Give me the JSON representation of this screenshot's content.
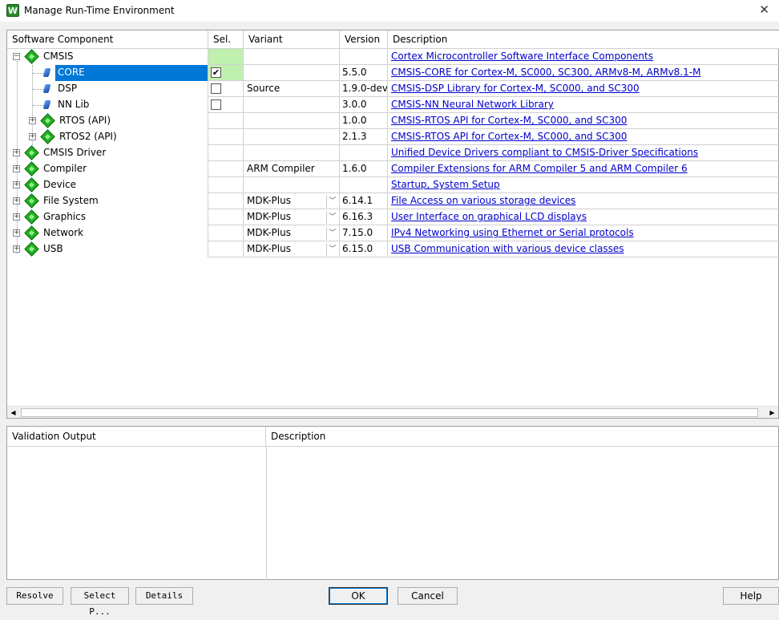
{
  "window": {
    "title": "Manage Run-Time Environment",
    "app_icon_letter": "W",
    "close_glyph": "✕"
  },
  "table": {
    "headers": {
      "component": "Software Component",
      "sel": "Sel.",
      "variant": "Variant",
      "version": "Version",
      "description": "Description"
    },
    "rows": [
      {
        "name": "CMSIS",
        "variant": "",
        "version": "",
        "description": "Cortex Microcontroller Software Interface Components",
        "expander": "−",
        "icon": "green-gem-icon"
      },
      {
        "name": "CORE",
        "variant": "",
        "version": "5.5.0",
        "description": "CMSIS-CORE for Cortex-M, SC000, SC300, ARMv8-M, ARMv8.1-M",
        "checked": "✔",
        "icon": "blue-pin-icon"
      },
      {
        "name": "DSP",
        "variant": "Source",
        "version": "1.9.0-dev",
        "description": "CMSIS-DSP Library for Cortex-M, SC000, and SC300",
        "icon": "blue-pin-icon"
      },
      {
        "name": "NN Lib",
        "variant": "",
        "version": "3.0.0",
        "description": "CMSIS-NN Neural Network Library",
        "icon": "blue-pin-icon"
      },
      {
        "name": "RTOS (API)",
        "variant": "",
        "version": "1.0.0",
        "description": "CMSIS-RTOS API for Cortex-M, SC000, and SC300",
        "expander": "+",
        "icon": "green-gem-icon"
      },
      {
        "name": "RTOS2 (API)",
        "variant": "",
        "version": "2.1.3",
        "description": "CMSIS-RTOS API for Cortex-M, SC000, and SC300",
        "expander": "+",
        "icon": "green-gem-icon"
      },
      {
        "name": "CMSIS Driver",
        "variant": "",
        "version": "",
        "description": "Unified Device Drivers compliant to CMSIS-Driver Specifications",
        "expander": "+",
        "icon": "green-gem-icon"
      },
      {
        "name": "Compiler",
        "variant": "ARM Compiler",
        "version": "1.6.0",
        "description": "Compiler Extensions for ARM Compiler 5 and ARM Compiler 6",
        "expander": "+",
        "icon": "green-gem-icon"
      },
      {
        "name": "Device",
        "variant": "",
        "version": "",
        "description": "Startup, System Setup",
        "expander": "+",
        "icon": "green-gem-icon"
      },
      {
        "name": "File System",
        "variant": "MDK-Plus",
        "version": "6.14.1",
        "description": "File Access on various storage devices",
        "expander": "+",
        "icon": "green-gem-icon"
      },
      {
        "name": "Graphics",
        "variant": "MDK-Plus",
        "version": "6.16.3",
        "description": "User Interface on graphical LCD displays",
        "expander": "+",
        "icon": "green-gem-icon"
      },
      {
        "name": "Network",
        "variant": "MDK-Plus",
        "version": "7.15.0",
        "description": "IPv4 Networking using Ethernet or Serial protocols",
        "expander": "+",
        "icon": "green-gem-icon"
      },
      {
        "name": "USB",
        "variant": "MDK-Plus",
        "version": "6.15.0",
        "description": "USB Communication with various device classes",
        "expander": "+",
        "icon": "green-gem-icon"
      }
    ],
    "dropdown_glyph": "﹀",
    "scroll_left": "◀",
    "scroll_right": "▶"
  },
  "validation": {
    "headers": {
      "output": "Validation Output",
      "description": "Description"
    }
  },
  "buttons": {
    "resolve": "Resolve",
    "select_packs": "Select P...",
    "details": "Details",
    "ok": "OK",
    "cancel": "Cancel",
    "help": "Help"
  },
  "colors": {
    "selection": "#0078d7",
    "sel_green": "#c0f0b0",
    "link": "#0000cc",
    "gem": "#22b022"
  }
}
